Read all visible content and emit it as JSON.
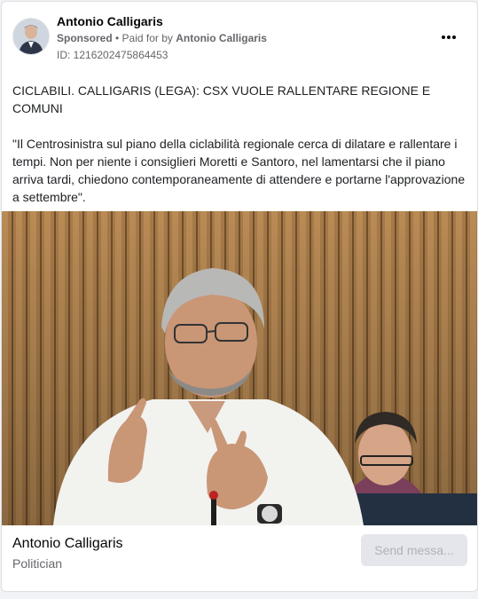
{
  "post": {
    "advertiser_name": "Antonio Calligaris",
    "sponsored_label": "Sponsored",
    "separator": " • ",
    "paid_for_prefix": "Paid for by ",
    "paid_for_name": "Antonio Calligaris",
    "ad_id": "ID: 1216202475864453",
    "headline": "CICLABILI. CALLIGARIS (LEGA): CSX VUOLE RALLENTARE REGIONE E COMUNI",
    "body": "\"Il Centrosinistra sul piano della ciclabilità regionale cerca di dilatare e rallentare i tempi. Non per niente i consiglieri Moretti e Santoro, nel lamentarsi che il piano arriva tardi, chiedono contemporaneamente di attendere e portarne l'approvazione a settembre\".",
    "truncation": "..."
  },
  "footer": {
    "page_name": "Antonio Calligaris",
    "page_category": "Politician",
    "cta_label": "Send messa..."
  },
  "icons": {
    "more": "more-options-icon"
  },
  "colors": {
    "name": "#050505",
    "secondary_text": "#65676b",
    "button_bg": "#e4e6eb",
    "button_text": "#aeb1b6",
    "wall_wood": "#a77a48"
  }
}
